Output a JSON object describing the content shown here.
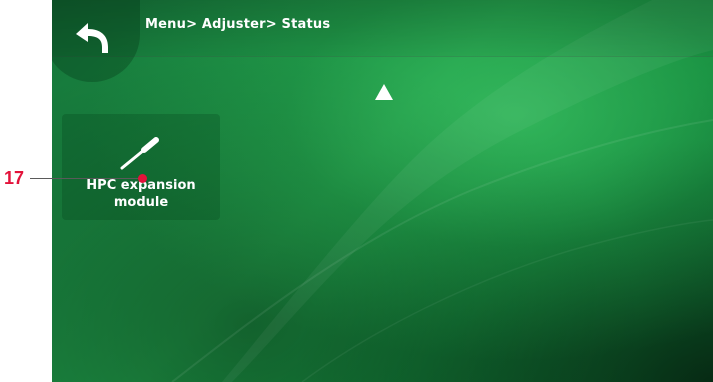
{
  "screen": {
    "breadcrumb": "Menu> Adjuster> Status",
    "tiles": [
      {
        "label": "HPC expansion module",
        "icon": "screwdriver-icon"
      }
    ],
    "back_icon": "back-arrow-icon",
    "scroll_icon": "up-triangle-icon"
  },
  "callout": {
    "number": "17",
    "color": "#e3123a"
  },
  "colors": {
    "background_green": "#1f9a48",
    "text": "#ffffff"
  }
}
